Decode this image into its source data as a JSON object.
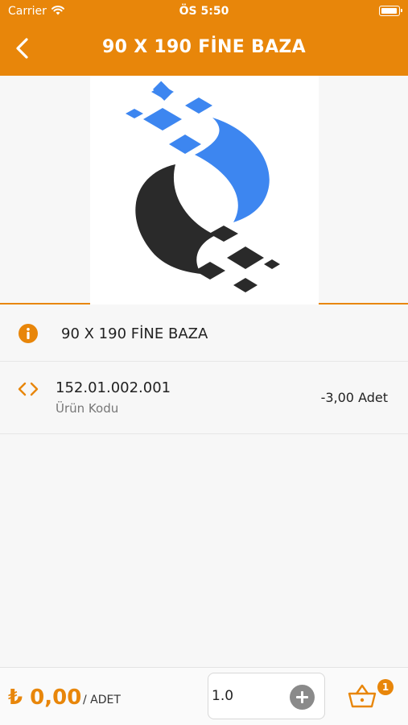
{
  "status_bar": {
    "carrier": "Carrier",
    "time": "ÖS 5:50"
  },
  "header": {
    "title": "90 X 190 FİNE BAZA",
    "back_icon": "chevron-left-icon",
    "color": "#e8860a"
  },
  "product": {
    "name": "90 X 190 FİNE BAZA",
    "code": "152.01.002.001",
    "code_label": "Ürün Kodu",
    "stock": "-3,00 Adet",
    "info_icon": "info-icon",
    "code_icon": "code-icon"
  },
  "bottom_bar": {
    "price": "₺ 0,00",
    "price_unit": "/ ADET",
    "quantity": "1.0",
    "plus_icon": "plus-circle-icon",
    "cart_icon": "basket-icon",
    "cart_count": "1"
  },
  "colors": {
    "accent": "#e8860a",
    "logo_blue": "#3d86f0",
    "logo_dark": "#2a2a2a"
  }
}
